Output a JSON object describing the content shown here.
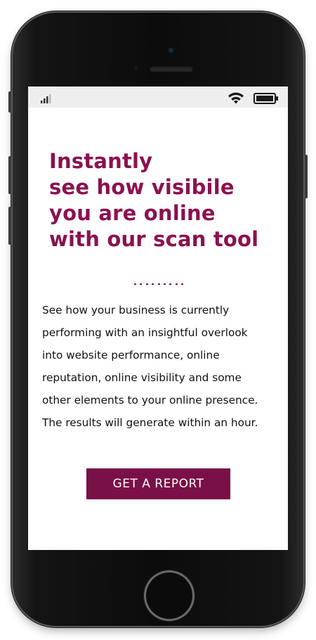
{
  "hero": {
    "headline": "Instantly\nsee how visibile\nyou are online\nwith our scan tool",
    "description": "See how your business is currently\nperforming with an insightful overlook\ninto website performance, online\nreputation, online visibility and some\nother elements to your online presence.\nThe results will generate within an hour.",
    "cta_label": "GET A REPORT"
  },
  "status_bar": {
    "icons": [
      "cellular-signal-icon",
      "wifi-icon",
      "battery-icon"
    ]
  },
  "colors": {
    "accent": "#8b1150",
    "button": "#7a1048",
    "status_bar_bg": "#eeeeee",
    "phone_body": "#0c0c0c"
  }
}
